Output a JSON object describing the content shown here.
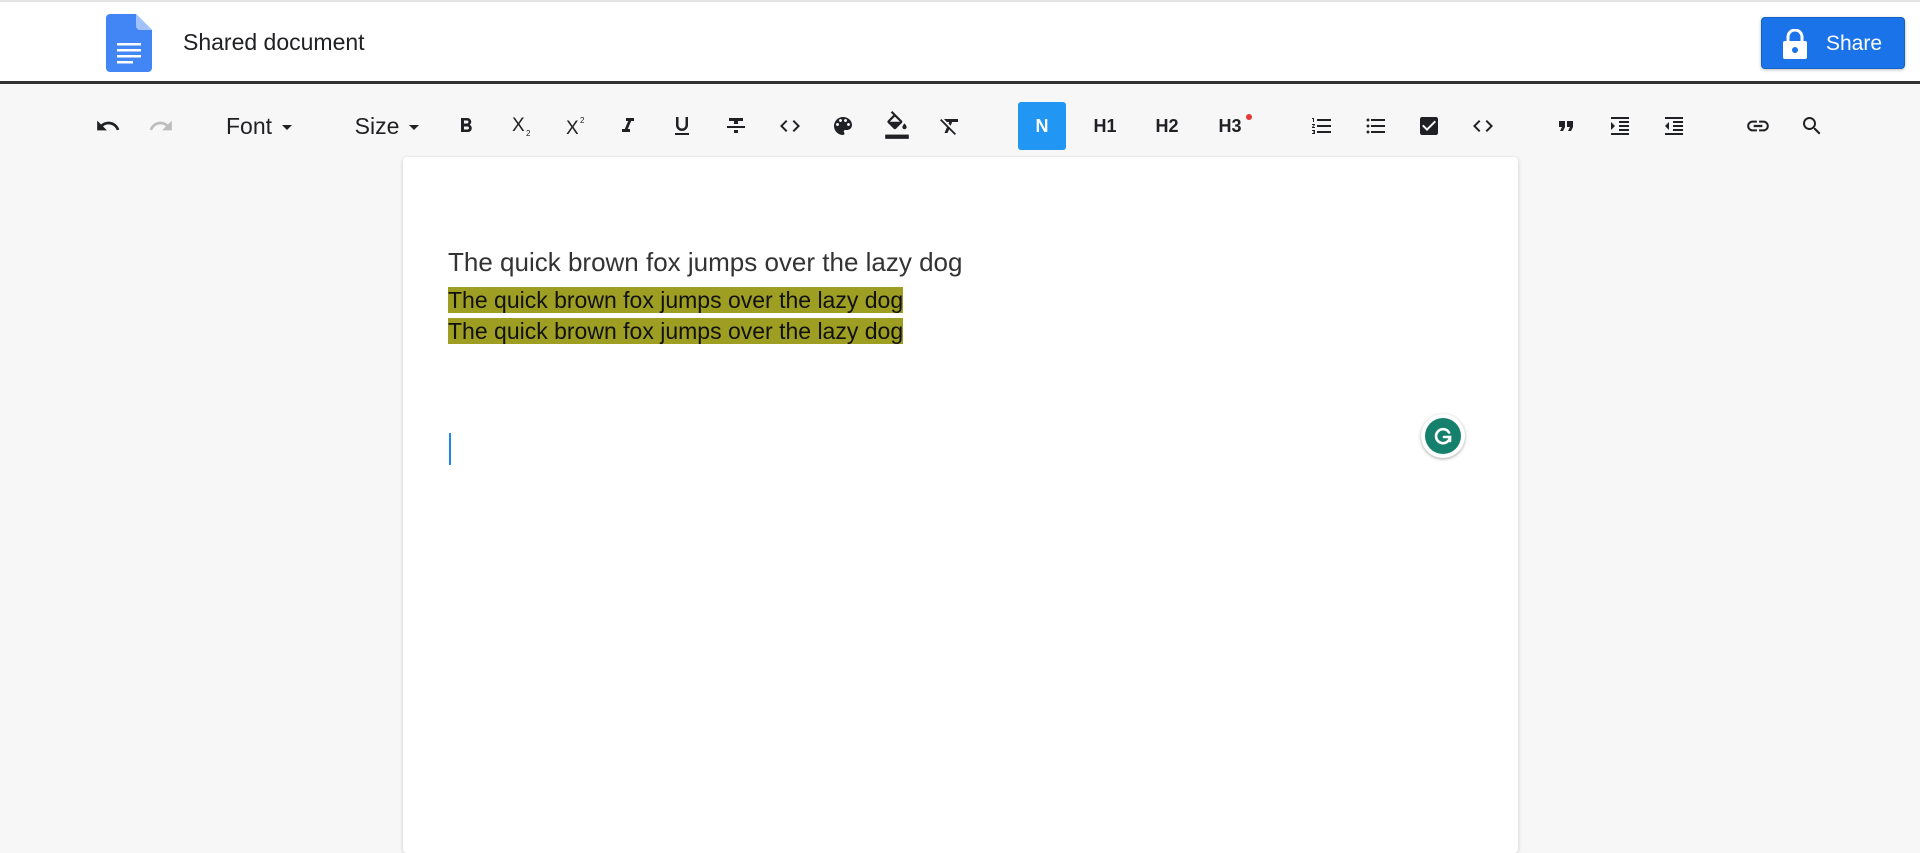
{
  "header": {
    "doc_title": "Shared document",
    "share_label": "Share",
    "logo_icon": "google-docs-icon",
    "share_color": "#1a73e8"
  },
  "toolbar": {
    "font_label": "Font",
    "size_label": "Size",
    "normal_label": "N",
    "h1_label": "H1",
    "h2_label": "H2",
    "h3_label": "H3",
    "active_color": "#2196f3",
    "icons": [
      "undo-icon",
      "redo-icon",
      "bold-icon",
      "subscript-icon",
      "superscript-icon",
      "italic-icon",
      "underline-icon",
      "strikethrough-icon",
      "inline-code-icon",
      "palette-icon",
      "fill-color-icon",
      "clear-format-icon",
      "ordered-list-icon",
      "bullet-list-icon",
      "checklist-icon",
      "code-block-icon",
      "quote-icon",
      "indent-icon",
      "outdent-icon",
      "link-icon",
      "search-icon"
    ]
  },
  "document": {
    "lines": [
      "The quick brown fox jumps over the lazy dog",
      "The quick brown fox jumps over the lazy dog",
      "The quick brown fox jumps over the lazy dog"
    ],
    "highlight_color": "#9e9e23"
  },
  "grammarly": {
    "icon": "grammarly-icon",
    "color": "#15806b"
  }
}
